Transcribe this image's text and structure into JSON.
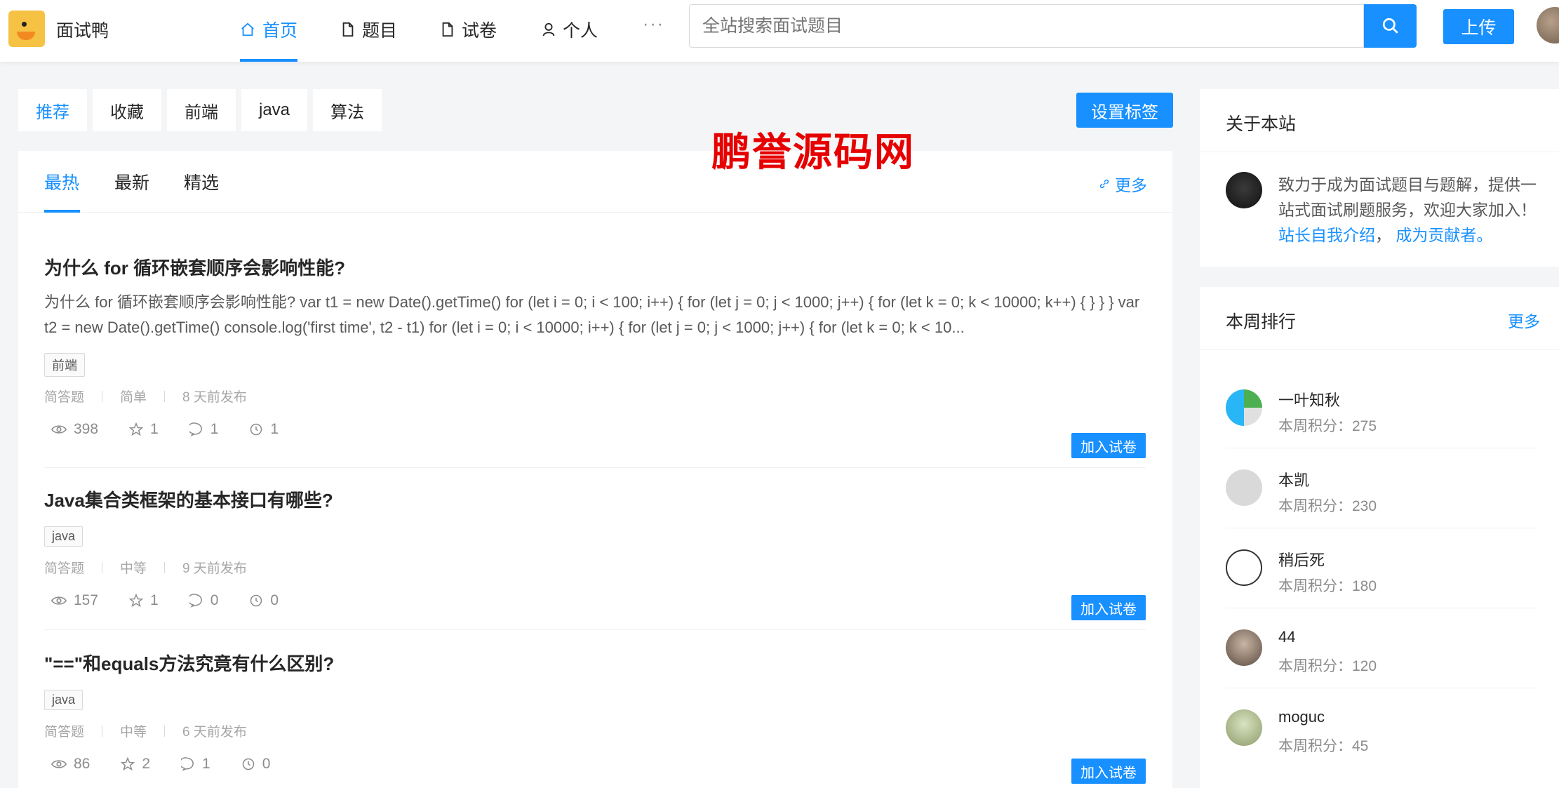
{
  "header": {
    "brand": "面试鸭",
    "nav": [
      {
        "label": "首页",
        "icon": "home-icon"
      },
      {
        "label": "题目",
        "icon": "file-icon"
      },
      {
        "label": "试卷",
        "icon": "paper-icon"
      },
      {
        "label": "个人",
        "icon": "user-icon"
      }
    ],
    "more": "···",
    "search_placeholder": "全站搜索面试题目",
    "upload_label": "上传"
  },
  "tags": [
    "推荐",
    "收藏",
    "前端",
    "java",
    "算法"
  ],
  "set_tags_label": "设置标签",
  "watermark": "鹏誉源码网",
  "sub_tabs": [
    "最热",
    "最新",
    "精选"
  ],
  "more_label": "更多",
  "questions": [
    {
      "title": "为什么 for 循环嵌套顺序会影响性能?",
      "desc": "为什么 for 循环嵌套顺序会影响性能? var t1 = new Date().getTime() for (let i = 0; i < 100; i++) { for (let j = 0; j < 1000; j++) { for (let k = 0; k < 10000; k++) { } } } var t2 = new Date().getTime() console.log('first time', t2 - t1) for (let i = 0; i < 10000; i++) { for (let j = 0; j < 1000; j++) { for (let k = 0; k < 10...",
      "tag": "前端",
      "type": "简答题",
      "difficulty": "简单",
      "time": "8 天前发布",
      "views": "398",
      "stars": "1",
      "comments": "1",
      "history": "1",
      "button": "加入试卷"
    },
    {
      "title": "Java集合类框架的基本接口有哪些?",
      "desc": "",
      "tag": "java",
      "type": "简答题",
      "difficulty": "中等",
      "time": "9 天前发布",
      "views": "157",
      "stars": "1",
      "comments": "0",
      "history": "0",
      "button": "加入试卷"
    },
    {
      "title": "\"==\"和equals方法究竟有什么区别?",
      "desc": "",
      "tag": "java",
      "type": "简答题",
      "difficulty": "中等",
      "time": "6 天前发布",
      "views": "86",
      "stars": "2",
      "comments": "1",
      "history": "0",
      "button": "加入试卷"
    }
  ],
  "about": {
    "title": "关于本站",
    "text": "致力于成为面试题目与题解，提供一站式面试刷题服务，欢迎大家加入！",
    "link1": "站长自我介绍",
    "link2": "成为贡献者。"
  },
  "ranking": {
    "title": "本周排行",
    "more": "更多",
    "items": [
      {
        "name": "一叶知秋",
        "score": "本周积分：275",
        "avatar_color": "#4caf50"
      },
      {
        "name": "本凯",
        "score": "本周积分：230",
        "avatar_color": "#d9d9d9"
      },
      {
        "name": "稍后死",
        "score": "本周积分：180",
        "avatar_color": "#333333"
      },
      {
        "name": "44",
        "score": "本周积分：120",
        "avatar_color": "#6b5b50"
      },
      {
        "name": "moguc",
        "score": "本周积分：45",
        "avatar_color": "#9fb27a"
      }
    ]
  }
}
